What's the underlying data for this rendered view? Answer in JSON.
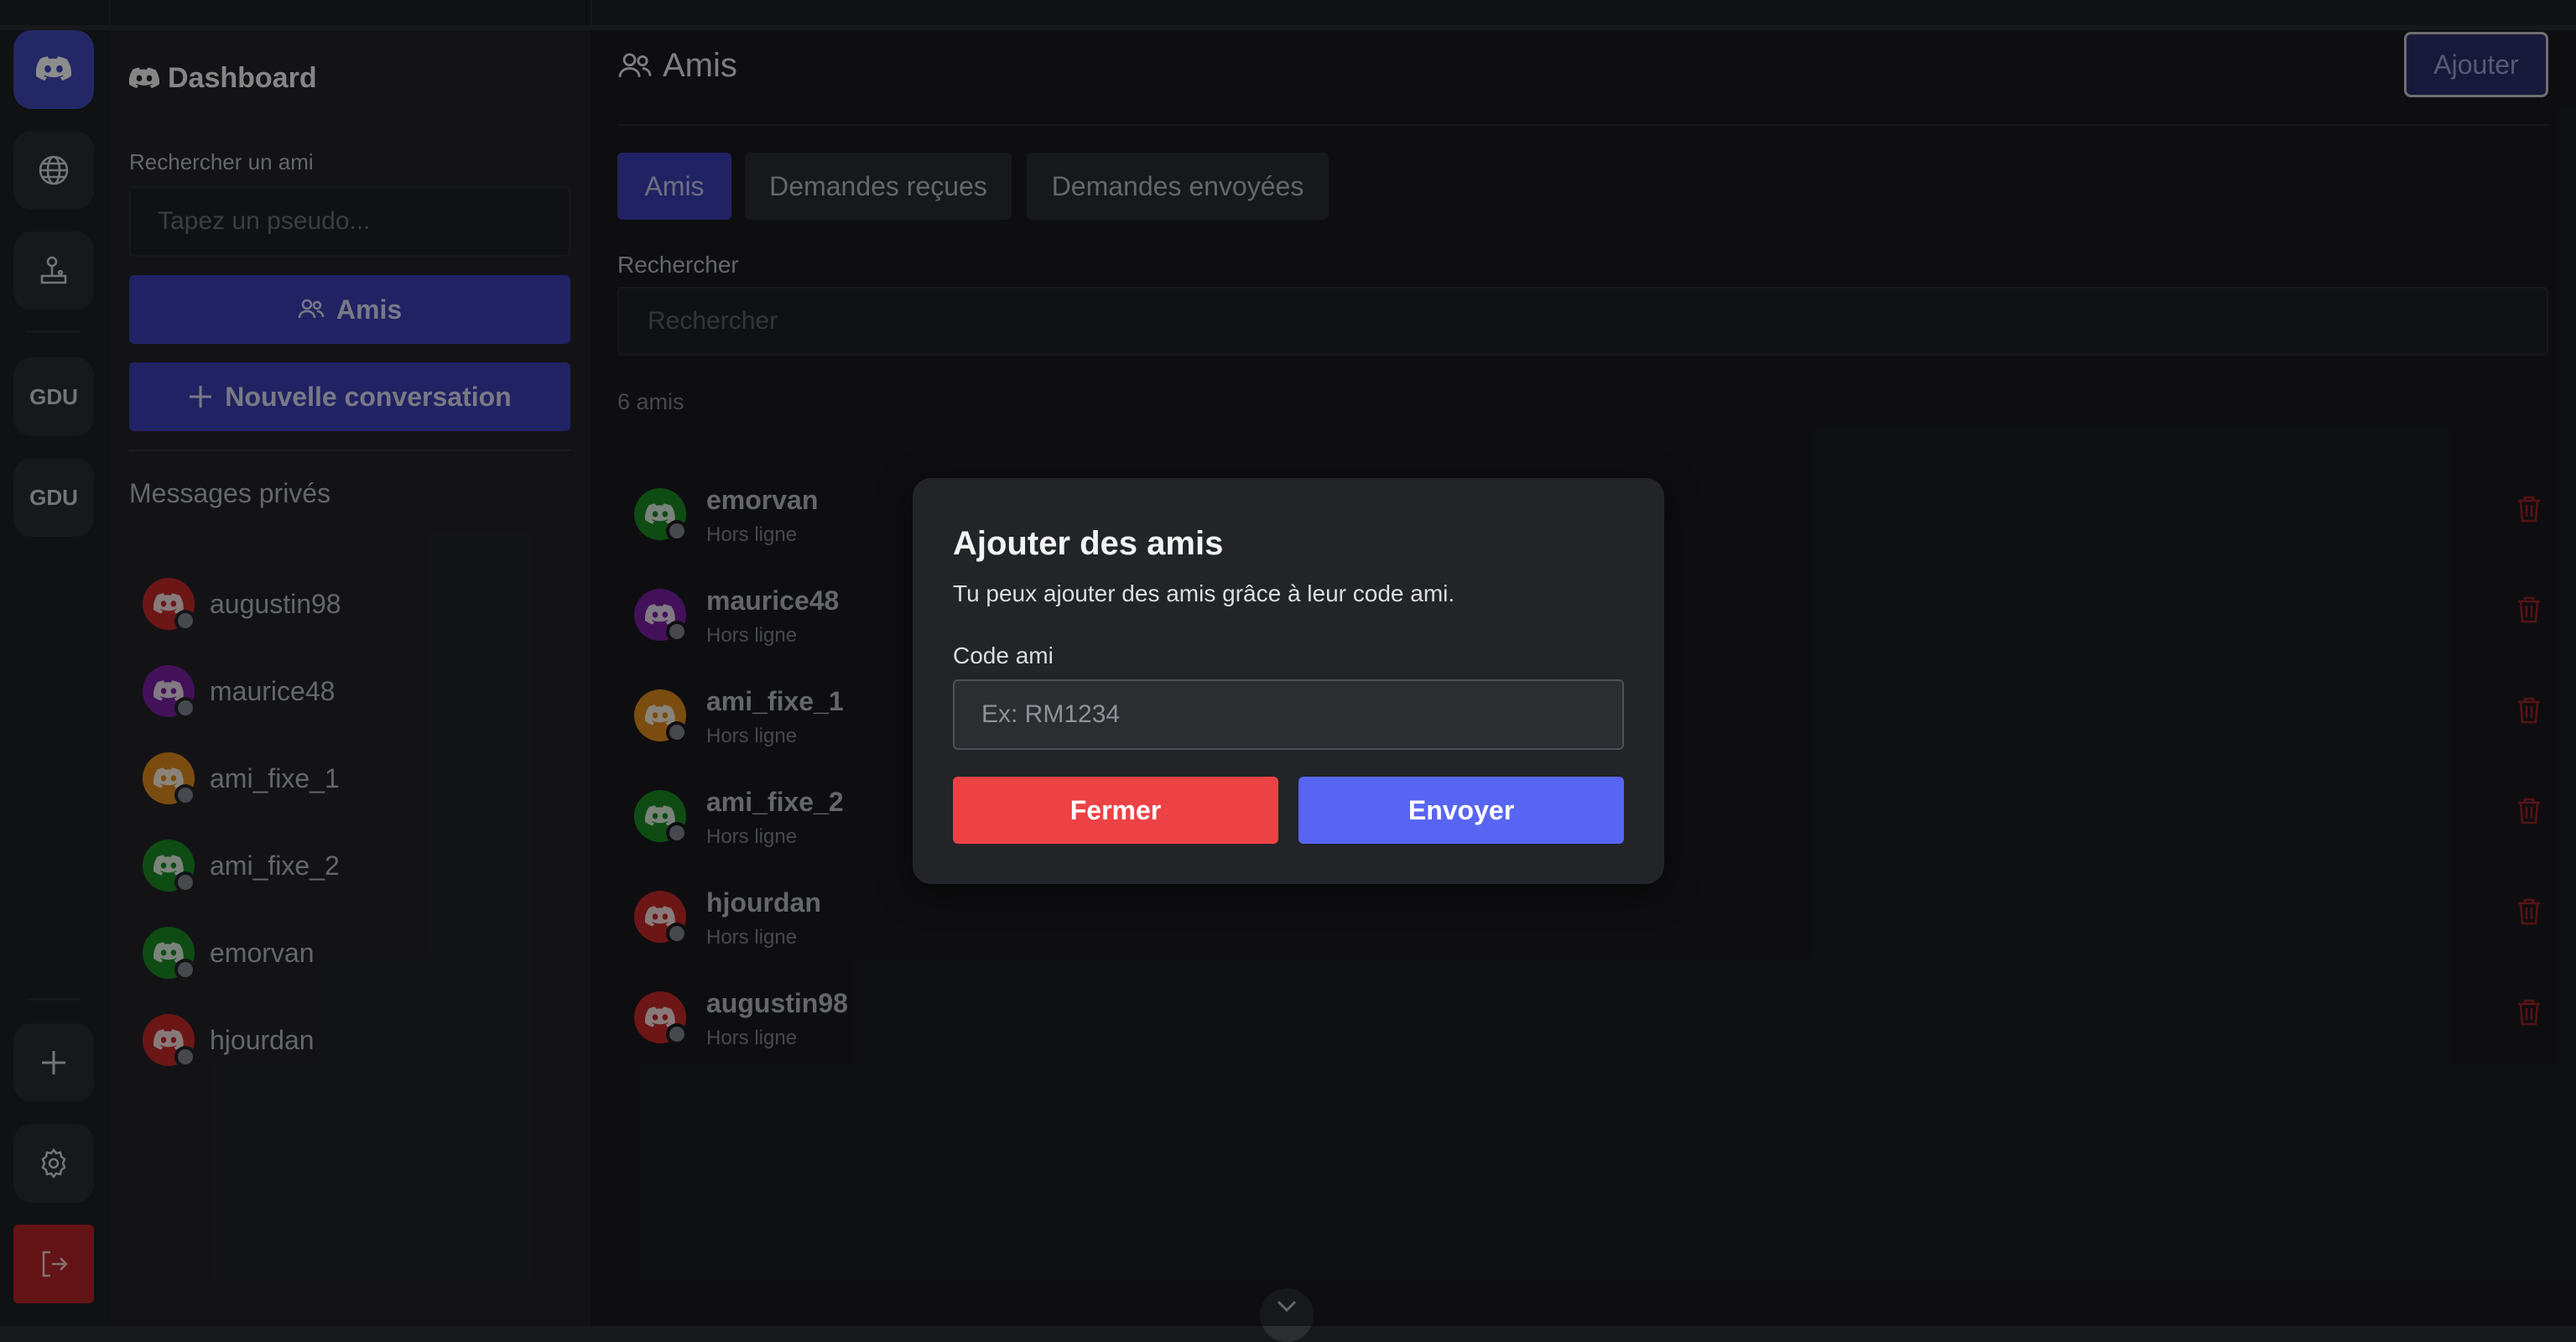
{
  "rail": {
    "servers": [
      "GDU",
      "GDU"
    ]
  },
  "sidebar": {
    "title": "Dashboard",
    "search_label": "Rechercher un ami",
    "search_placeholder": "Tapez un pseudo...",
    "friends_button": "Amis",
    "new_conversation_button": "Nouvelle conversation",
    "dm_section_title": "Messages privés",
    "dms": [
      {
        "name": "augustin98",
        "color": "#c62828"
      },
      {
        "name": "maurice48",
        "color": "#7b1fa2"
      },
      {
        "name": "ami_fixe_1",
        "color": "#e08a1e"
      },
      {
        "name": "ami_fixe_2",
        "color": "#1b8a24"
      },
      {
        "name": "emorvan",
        "color": "#1b8a24"
      },
      {
        "name": "hjourdan",
        "color": "#c62828"
      }
    ]
  },
  "main": {
    "title": "Amis",
    "add_button": "Ajouter",
    "tabs": [
      {
        "label": "Amis",
        "active": true
      },
      {
        "label": "Demandes reçues",
        "active": false
      },
      {
        "label": "Demandes envoyées",
        "active": false
      }
    ],
    "search_label": "Rechercher",
    "search_placeholder": "Rechercher",
    "count": "6 amis",
    "friends": [
      {
        "name": "emorvan",
        "status": "Hors ligne",
        "color": "#1b8a24"
      },
      {
        "name": "maurice48",
        "status": "Hors ligne",
        "color": "#7b1fa2"
      },
      {
        "name": "ami_fixe_1",
        "status": "Hors ligne",
        "color": "#e08a1e"
      },
      {
        "name": "ami_fixe_2",
        "status": "Hors ligne",
        "color": "#1b8a24"
      },
      {
        "name": "hjourdan",
        "status": "Hors ligne",
        "color": "#c62828"
      },
      {
        "name": "augustin98",
        "status": "Hors ligne",
        "color": "#c62828"
      }
    ]
  },
  "modal": {
    "title": "Ajouter des amis",
    "description": "Tu peux ajouter des amis grâce à leur code ami.",
    "code_label": "Code ami",
    "code_placeholder": "Ex: RM1234",
    "close_button": "Fermer",
    "send_button": "Envoyer"
  },
  "colors": {
    "accent": "#5865f2",
    "danger": "#ed4245",
    "logout": "#b3262a"
  }
}
